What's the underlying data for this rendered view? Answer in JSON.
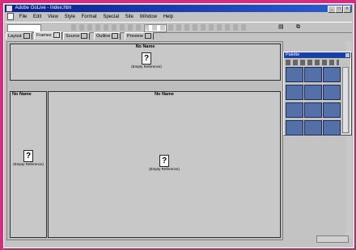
{
  "window": {
    "title": "Adobe GoLive - Index.htm"
  },
  "menu": [
    "File",
    "Edit",
    "View",
    "Style",
    "Format",
    "Special",
    "Site",
    "Window",
    "Help"
  ],
  "tabs": [
    "Layout",
    "Frames",
    "Source",
    "Outline",
    "Preview"
  ],
  "frames": {
    "top": {
      "name": "No Name",
      "placeholder": "(Empty Reference)"
    },
    "left": {
      "name": "No Name",
      "placeholder": "(Empty Reference)"
    },
    "main": {
      "name": "No Name",
      "placeholder": "(Empty Reference)"
    }
  },
  "palette": {
    "title": "Palette"
  }
}
